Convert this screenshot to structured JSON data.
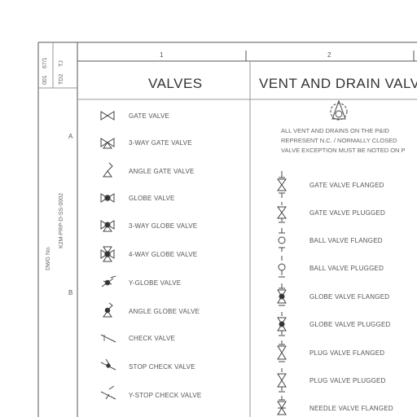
{
  "sheet": {
    "column_numbers": [
      "1",
      "2"
    ],
    "row_letters": [
      "A",
      "B"
    ],
    "side_text": {
      "top_a": "67/1",
      "top_b": "TJ",
      "top_c": "001",
      "top_d": "TD2",
      "mid": "K2M-PRP-D-SS-0002",
      "mid_b": "DWG No."
    }
  },
  "valves": {
    "title": "VALVES",
    "items": [
      {
        "label": "GATE VALVE",
        "icon": "gate-valve-icon"
      },
      {
        "label": "3-WAY GATE VALVE",
        "icon": "three-way-gate-valve-icon"
      },
      {
        "label": "ANGLE GATE VALVE",
        "icon": "angle-gate-valve-icon"
      },
      {
        "label": "GLOBE VALVE",
        "icon": "globe-valve-icon"
      },
      {
        "label": "3-WAY GLOBE VALVE",
        "icon": "three-way-globe-valve-icon"
      },
      {
        "label": "4-WAY GLOBE VALVE",
        "icon": "four-way-globe-valve-icon"
      },
      {
        "label": "Y-GLOBE VALVE",
        "icon": "y-globe-valve-icon"
      },
      {
        "label": "ANGLE GLOBE VALVE",
        "icon": "angle-globe-valve-icon"
      },
      {
        "label": "CHECK VALVE",
        "icon": "check-valve-icon"
      },
      {
        "label": "STOP CHECK VALVE",
        "icon": "stop-check-valve-icon"
      },
      {
        "label": "Y-STOP CHECK VALVE",
        "icon": "y-stop-check-valve-icon"
      }
    ]
  },
  "vent_drain": {
    "title": "VENT AND DRAIN VALV",
    "note_lines": [
      "ALL VENT AND DRAINS ON THE P&ID",
      "REPRESENT N.C. / NORMALLY CLOSED",
      "VALVE EXCEPTION MUST BE NOTED ON P"
    ],
    "items": [
      {
        "label": "GATE VALVE FLANGED",
        "icon": "gate-valve-flanged-icon"
      },
      {
        "label": "GATE VALVE PLUGGED",
        "icon": "gate-valve-plugged-icon"
      },
      {
        "label": "BALL VALVE FLANGED",
        "icon": "ball-valve-flanged-icon"
      },
      {
        "label": "BALL VALVE PLUGGED",
        "icon": "ball-valve-plugged-icon"
      },
      {
        "label": "GLOBE VALVE FLANGED",
        "icon": "globe-valve-flanged-icon"
      },
      {
        "label": "GLOBE VALVE PLUGGED",
        "icon": "globe-valve-plugged-icon"
      },
      {
        "label": "PLUG VALVE FLANGED",
        "icon": "plug-valve-flanged-icon"
      },
      {
        "label": "PLUG VALVE PLUGGED",
        "icon": "plug-valve-plugged-icon"
      },
      {
        "label": "NEEDLE VALVE FLANGED",
        "icon": "needle-valve-flanged-icon"
      }
    ]
  }
}
